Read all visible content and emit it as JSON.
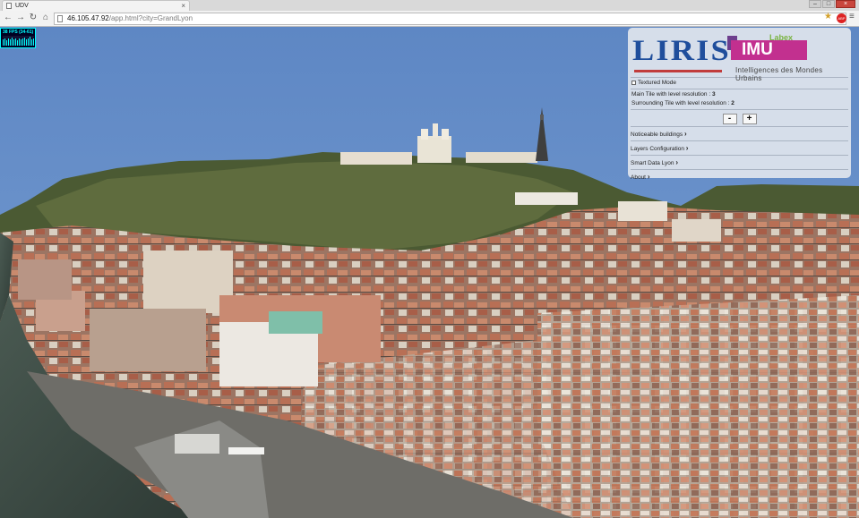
{
  "browser": {
    "tab_title": "UDV",
    "tab_close": "×",
    "window_controls": [
      "–",
      "□",
      "×"
    ],
    "url_host": "46.105.47.92",
    "url_path": "/app.html?city=GrandLyon",
    "icons": [
      "back-arrow-icon",
      "forward-arrow-icon",
      "reload-icon",
      "home-icon",
      "star-icon",
      "adblock-icon",
      "menu-icon"
    ]
  },
  "stats": {
    "fps_text": "38 FPS (34-61)"
  },
  "panel": {
    "liris_logo": "LIRIS",
    "labex": "Labex",
    "imu_logo": "IMU",
    "imu_subtitle": "Intelligences des Mondes Urbains",
    "textured_mode_label": "Textured Mode",
    "main_tile_label": "Main Tile with level resolution : ",
    "main_tile_value": "3",
    "surrounding_tile_label": "Surrounding Tile with level resolution : ",
    "surrounding_tile_value": "2",
    "minus_label": "-",
    "plus_label": "+",
    "links": [
      "Noticeable buildings",
      "Layers Configuration",
      "Smart Data Lyon",
      "About"
    ]
  },
  "colors": {
    "sky": "#6c93cc",
    "panel_bg": "#d6deea",
    "liris_blue": "#1f4e9c",
    "imu_magenta": "#c2308f"
  }
}
